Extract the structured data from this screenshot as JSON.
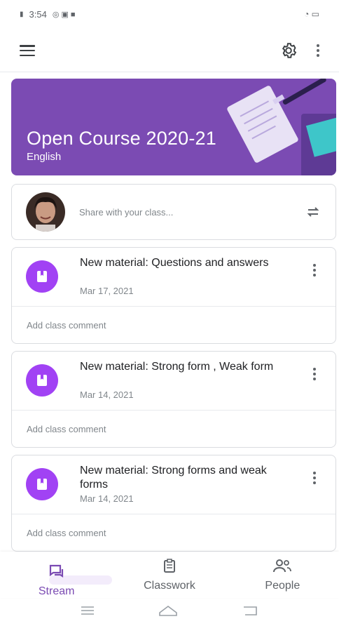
{
  "status_bar": {
    "time": "3:54"
  },
  "app_bar": {
    "menu_icon": "hamburger-menu-icon",
    "settings_icon": "gear-icon",
    "more_icon": "more-vert-icon"
  },
  "banner": {
    "title": "Open Course 2020-21",
    "subtitle": "English",
    "bg_color": "#7b4bb3"
  },
  "share": {
    "placeholder": "Share with your class..."
  },
  "posts": [
    {
      "title": "New material: Questions and answers",
      "date": "Mar 17, 2021",
      "comment": "Add class comment"
    },
    {
      "title": "New material: Strong form , Weak form",
      "date": "Mar 14, 2021",
      "comment": "Add class comment"
    },
    {
      "title": "New material: Strong forms and weak forms",
      "date": "Mar 14, 2021",
      "comment": "Add class comment"
    }
  ],
  "bottom_nav": [
    {
      "label": "Stream",
      "icon": "stream-icon",
      "active": true
    },
    {
      "label": "Classwork",
      "icon": "classwork-icon",
      "active": false
    },
    {
      "label": "People",
      "icon": "people-icon",
      "active": false
    }
  ],
  "colors": {
    "accent": "#7b4bb3",
    "material_icon": "#a142f4"
  }
}
